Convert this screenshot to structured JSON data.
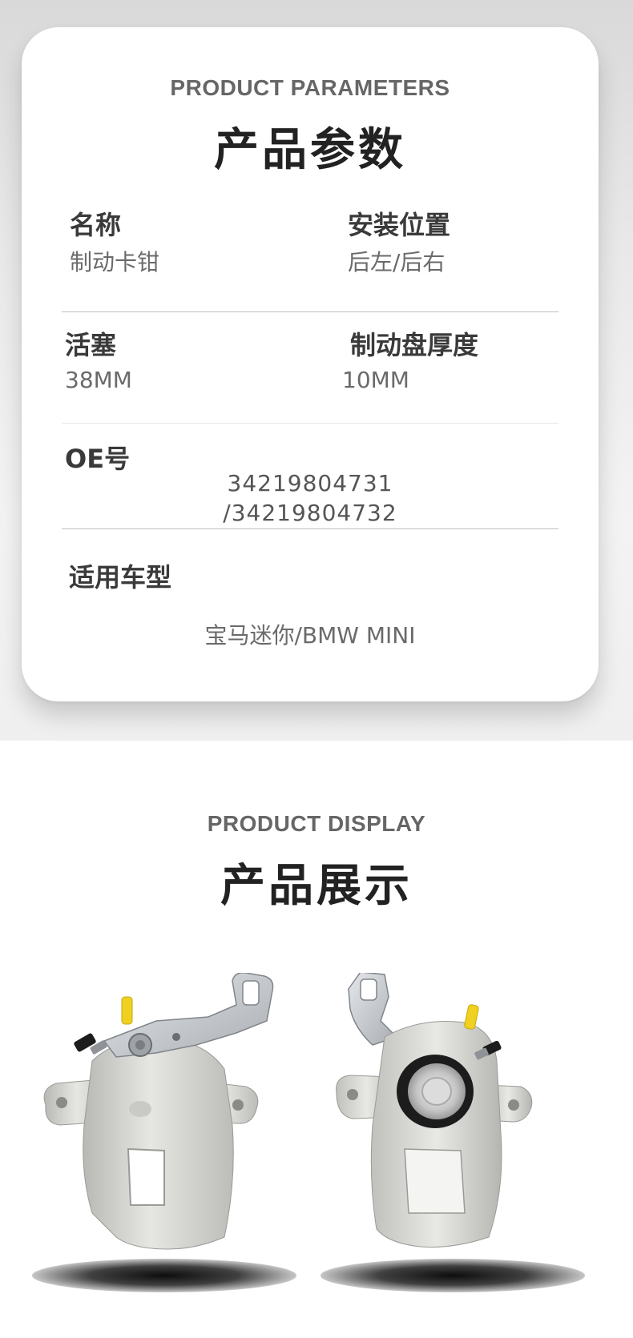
{
  "parameters": {
    "en_title": "PRODUCT PARAMETERS",
    "cn_title": "产品参数",
    "items": [
      {
        "label": "名称",
        "value": "制动卡钳"
      },
      {
        "label": "安装位置",
        "value": "后左/后右"
      },
      {
        "label": "活塞",
        "value": "38MM"
      },
      {
        "label": "制动盘厚度",
        "value": "10MM"
      },
      {
        "label": "OE号",
        "value_line1": "34219804731",
        "value_line2": "/34219804732"
      },
      {
        "label": "适用车型",
        "value": "宝马迷你/BMW MINI"
      }
    ]
  },
  "display": {
    "en_title": "PRODUCT DISPLAY",
    "cn_title": "产品展示",
    "images": [
      {
        "icon": "brake-caliper-rear-view-image"
      },
      {
        "icon": "brake-caliper-piston-view-image"
      }
    ]
  },
  "colors": {
    "caliper_body": "#d8d8d4",
    "caliper_shade": "#a9a9a5",
    "bleed_cap": "#f0d020",
    "piston_seal": "#1c1c1c",
    "bracket": "#c9ccd0"
  }
}
